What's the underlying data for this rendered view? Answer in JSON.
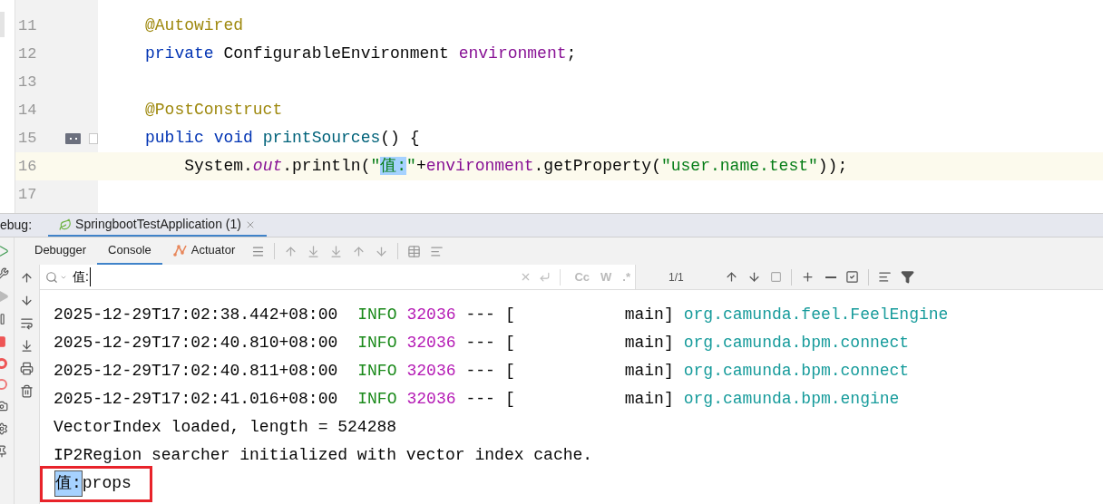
{
  "editor": {
    "lines": [
      {
        "number": "11",
        "current": false,
        "tokens": [
          {
            "kind": "annotation",
            "text": "@Autowired"
          }
        ]
      },
      {
        "number": "12",
        "current": false,
        "tokens": [
          {
            "kind": "keyword",
            "text": "private "
          },
          {
            "kind": "plain",
            "text": "ConfigurableEnvironment "
          },
          {
            "kind": "field",
            "text": "environment"
          },
          {
            "kind": "plain",
            "text": ";"
          }
        ]
      },
      {
        "number": "13",
        "current": false
      },
      {
        "number": "14",
        "current": false,
        "tokens": [
          {
            "kind": "annotation",
            "text": "@PostConstruct"
          }
        ]
      },
      {
        "number": "15",
        "current": false,
        "gutter_icon": true,
        "tokens": [
          {
            "kind": "keyword",
            "text": "public "
          },
          {
            "kind": "keyword",
            "text": "void "
          },
          {
            "kind": "method",
            "text": "printSources"
          },
          {
            "kind": "plain",
            "text": "() {"
          }
        ]
      },
      {
        "number": "16",
        "current": true,
        "tokens": [
          {
            "kind": "plain",
            "text": "    System."
          },
          {
            "kind": "static",
            "text": "out"
          },
          {
            "kind": "plain",
            "text": ".println("
          },
          {
            "kind": "string",
            "text": "\""
          },
          {
            "kind": "match",
            "text": "值:"
          },
          {
            "kind": "string",
            "text": "\""
          },
          {
            "kind": "plain",
            "text": "+"
          },
          {
            "kind": "field",
            "text": "environment"
          },
          {
            "kind": "plain",
            "text": ".getProperty("
          },
          {
            "kind": "string",
            "text": "\"user.name.test\""
          },
          {
            "kind": "plain",
            "text": "));"
          }
        ]
      },
      {
        "number": "17",
        "current": false
      }
    ]
  },
  "debug_bar": {
    "label": "ebug:",
    "tabs": [
      {
        "label": "SpringbootTestApplication (1)",
        "selected": true
      }
    ]
  },
  "tool_tabs": [
    {
      "label": "Debugger",
      "selected": false
    },
    {
      "label": "Console",
      "selected": true
    },
    {
      "label": "Actuator",
      "selected": false,
      "icon": true
    }
  ],
  "search": {
    "value": "值:",
    "options": [
      "Cc",
      "W",
      ".*"
    ],
    "count": "1/1"
  },
  "console": [
    {
      "kind": "log",
      "timestamp": "2025-12-29T17:02:38.442+08:00",
      "level": "INFO",
      "pid": "32036",
      "separator": "---",
      "bracket": "[",
      "thread": "main]",
      "logger": "org.camunda.feel.FeelEngine"
    },
    {
      "kind": "log",
      "timestamp": "2025-12-29T17:02:40.810+08:00",
      "level": "INFO",
      "pid": "32036",
      "separator": "---",
      "bracket": "[",
      "thread": "main]",
      "logger": "org.camunda.bpm.connect"
    },
    {
      "kind": "log",
      "timestamp": "2025-12-29T17:02:40.811+08:00",
      "level": "INFO",
      "pid": "32036",
      "separator": "---",
      "bracket": "[",
      "thread": "main]",
      "logger": "org.camunda.bpm.connect"
    },
    {
      "kind": "log",
      "timestamp": "2025-12-29T17:02:41.016+08:00",
      "level": "INFO",
      "pid": "32036",
      "separator": "---",
      "bracket": "[",
      "thread": "main]",
      "logger": "org.camunda.bpm.engine"
    },
    {
      "kind": "text",
      "text": "VectorIndex loaded, length = 524288"
    },
    {
      "kind": "text",
      "text": "IP2Region searcher initialized with vector index cache."
    },
    {
      "kind": "match",
      "match": "值:",
      "text": "props",
      "boxed": true
    }
  ]
}
